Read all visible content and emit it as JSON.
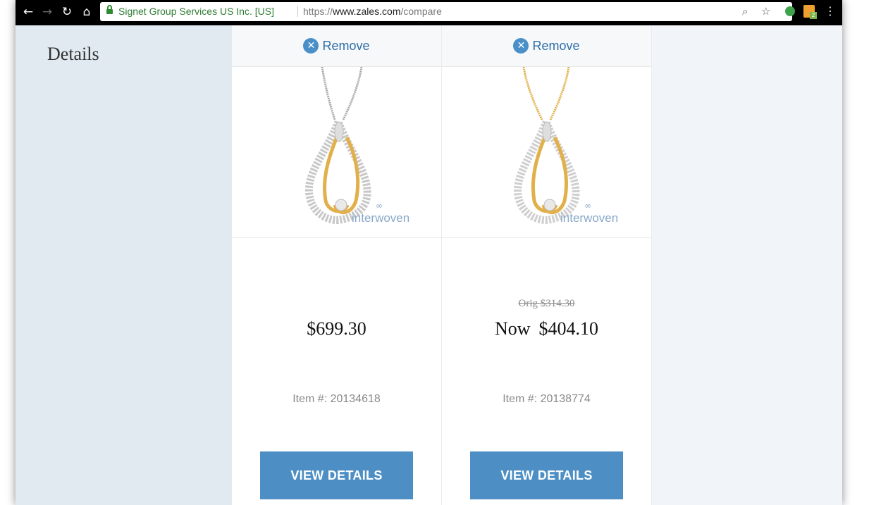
{
  "browser": {
    "back_icon": "back-arrow-icon",
    "forward_icon": "forward-arrow-icon",
    "reload_icon": "reload-icon",
    "home_icon": "home-icon",
    "site_identity": "Signet Group Services US Inc. [US]",
    "url_scheme": "https://",
    "url_host": "www.zales.com",
    "url_path": "/compare",
    "zoom_icon": "zoom-icon",
    "bookmark_icon": "star-icon",
    "menu_icon": "more-vert-icon"
  },
  "compare": {
    "details_label": "Details",
    "products": [
      {
        "remove_label": "Remove",
        "brand": "interwoven",
        "metal": "silver",
        "original_price": "",
        "price_prefix": "",
        "price": "$699.30",
        "item_number": "Item #: 20134618",
        "button_label": "VIEW DETAILS"
      },
      {
        "remove_label": "Remove",
        "brand": "interwoven",
        "metal": "gold",
        "original_price": "Orig  $314.30",
        "price_prefix": "Now",
        "price": "$404.10",
        "item_number": "Item #: 20138774",
        "button_label": "VIEW DETAILS"
      }
    ]
  },
  "colors": {
    "button_blue": "#4d8fc4",
    "link_blue": "#2f6fa8",
    "label_column_bg": "#e1eaf1",
    "gold": "#e2b04a",
    "secure_green": "#2e7d32"
  }
}
